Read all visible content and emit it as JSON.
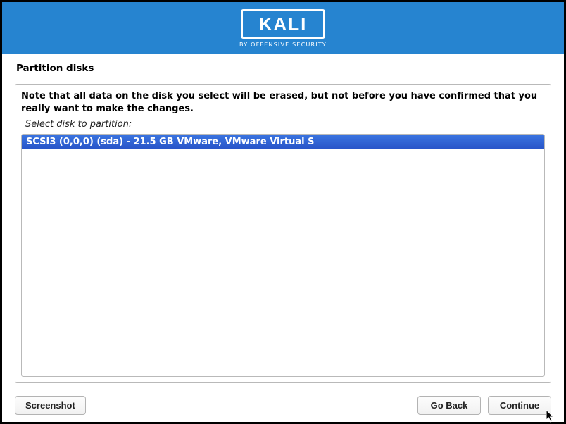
{
  "header": {
    "logo_text": "KALI",
    "subtitle": "BY OFFENSIVE SECURITY"
  },
  "page": {
    "title": "Partition disks",
    "instruction": "Note that all data on the disk you select will be erased, but not before you have confirmed that you really want to make the changes.",
    "select_label": "Select disk to partition:"
  },
  "disks": [
    {
      "label": "SCSI3 (0,0,0) (sda) - 21.5 GB VMware, VMware Virtual S",
      "selected": true
    }
  ],
  "buttons": {
    "screenshot": "Screenshot",
    "go_back": "Go Back",
    "continue": "Continue"
  },
  "colors": {
    "header_bg": "#2684d0",
    "selection_bg_top": "#3a74e0",
    "selection_bg_bottom": "#2854c8"
  }
}
